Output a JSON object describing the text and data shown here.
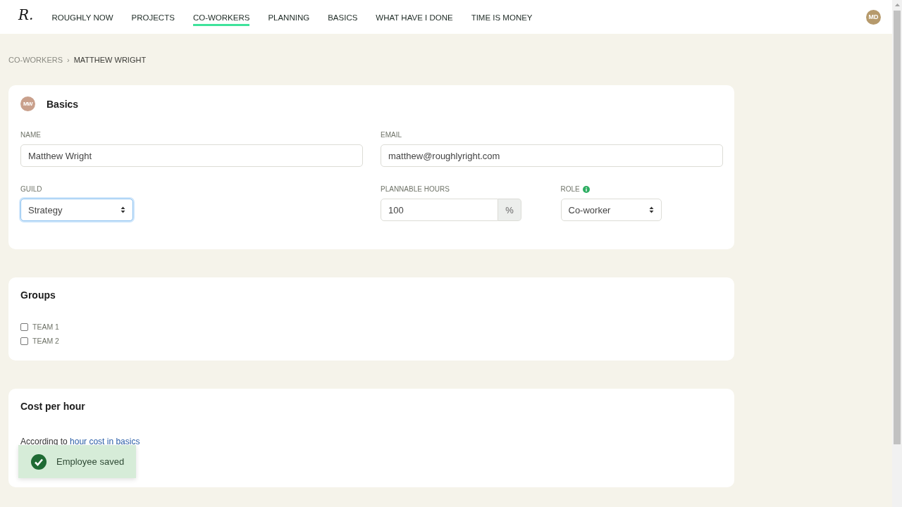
{
  "nav": {
    "logo": "R.",
    "items": [
      {
        "label": "ROUGHLY NOW",
        "selected": false
      },
      {
        "label": "PROJECTS",
        "selected": false
      },
      {
        "label": "CO-WORKERS",
        "selected": true
      },
      {
        "label": "PLANNING",
        "selected": false
      },
      {
        "label": "BASICS",
        "selected": false
      },
      {
        "label": "WHAT HAVE I DONE",
        "selected": false
      },
      {
        "label": "TIME IS MONEY",
        "selected": false
      }
    ],
    "avatar": "MD"
  },
  "breadcrumb": {
    "separator": "›",
    "items": [
      "CO-WORKERS",
      "MATTHEW WRIGHT"
    ]
  },
  "basics": {
    "avatar": "MW",
    "title": "Basics",
    "fields": [
      {
        "kind": "text",
        "label": "NAME",
        "value": "Matthew Wright",
        "focused": false
      },
      {
        "kind": "text",
        "label": "EMAIL",
        "value": "matthew@roughlyright.com",
        "focused": false
      },
      {
        "kind": "select",
        "label": "GUILD",
        "value": "Strategy",
        "focused": true
      },
      {
        "kind": "addon",
        "label": "PLANNABLE HOURS",
        "value": "100",
        "suffix": "%",
        "focused": false
      },
      {
        "kind": "select",
        "label": "ROLE",
        "value": "Co-worker",
        "info": true,
        "focused": false
      }
    ]
  },
  "groups": {
    "title": "Groups",
    "items": [
      {
        "label": "TEAM 1",
        "checked": false
      },
      {
        "label": "TEAM 2",
        "checked": false
      }
    ]
  },
  "cost": {
    "title": "Cost per hour",
    "note_before": "According to ",
    "note_link": "hour cost in basics"
  },
  "toast": {
    "message": "Employee saved"
  }
}
